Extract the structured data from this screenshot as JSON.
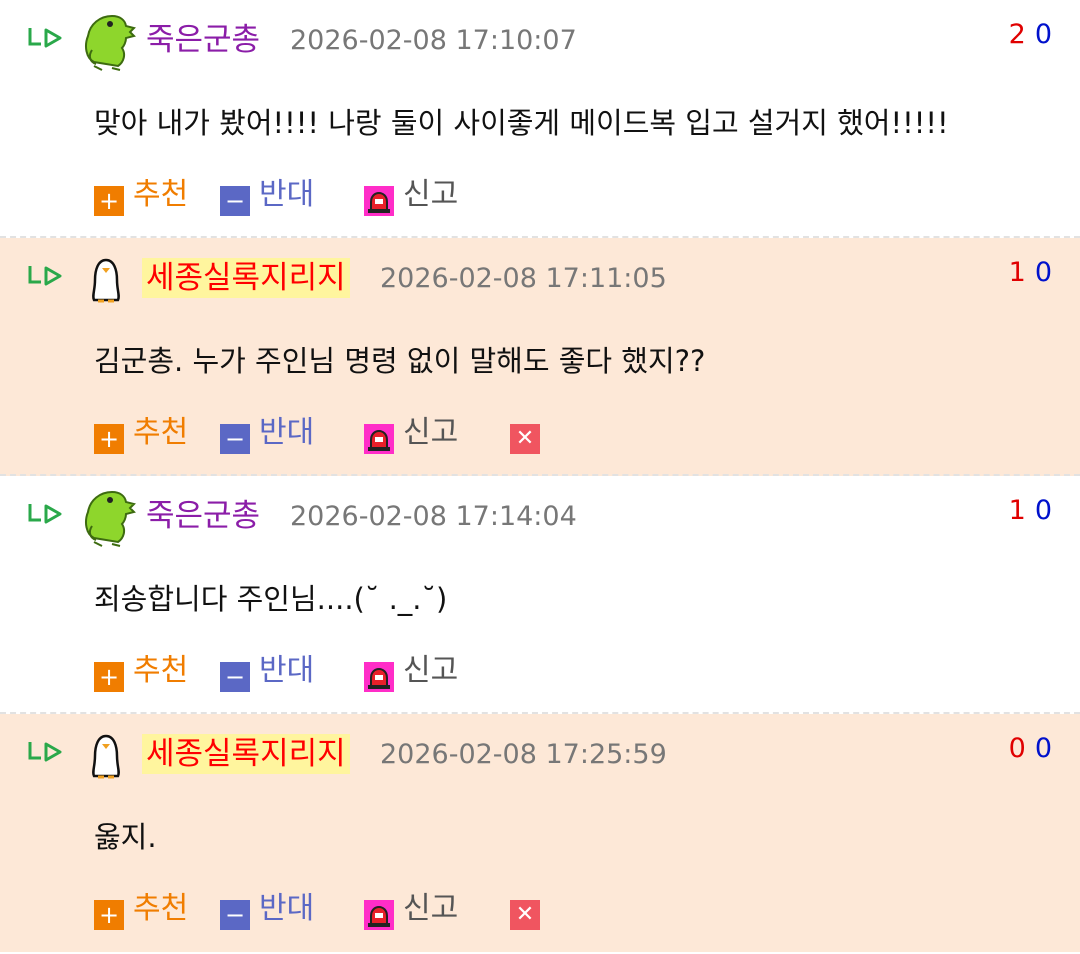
{
  "comments": [
    {
      "author": "죽은군총",
      "avatar": "frog-icon",
      "highlighted": false,
      "timestamp": "2026-02-08 17:10:07",
      "upvotes": "2",
      "downvotes": "0",
      "text": "맞아 내가 봤어!!!! 나랑 둘이 사이좋게 메이드복 입고 설거지 했어!!!!!",
      "recommend_label": "추천",
      "oppose_label": "반대",
      "report_label": "신고",
      "deletable": false
    },
    {
      "author": "세종실록지리지",
      "avatar": "penguin-icon",
      "highlighted": true,
      "timestamp": "2026-02-08 17:11:05",
      "upvotes": "1",
      "downvotes": "0",
      "text": "김군총. 누가 주인님 명령 없이 말해도 좋다 했지??",
      "recommend_label": "추천",
      "oppose_label": "반대",
      "report_label": "신고",
      "deletable": true
    },
    {
      "author": "죽은군총",
      "avatar": "frog-icon",
      "highlighted": false,
      "timestamp": "2026-02-08 17:14:04",
      "upvotes": "1",
      "downvotes": "0",
      "text": "죄송합니다 주인님....(˘ ._.˘)",
      "recommend_label": "추천",
      "oppose_label": "반대",
      "report_label": "신고",
      "deletable": false
    },
    {
      "author": "세종실록지리지",
      "avatar": "penguin-icon",
      "highlighted": true,
      "timestamp": "2026-02-08 17:25:59",
      "upvotes": "0",
      "downvotes": "0",
      "text": "옳지.",
      "recommend_label": "추천",
      "oppose_label": "반대",
      "report_label": "신고",
      "deletable": true
    }
  ],
  "colors": {
    "alt_background": "#fde8d7",
    "recommend": "#f07d00",
    "oppose": "#5b68c5",
    "report": "#ff2dc8",
    "delete": "#f05560",
    "upvote": "#e00000",
    "downvote": "#0011cc",
    "nick": "#8b1da8",
    "nick_highlight_bg": "#fff59e",
    "nick_highlight_fg": "#ff0000"
  }
}
